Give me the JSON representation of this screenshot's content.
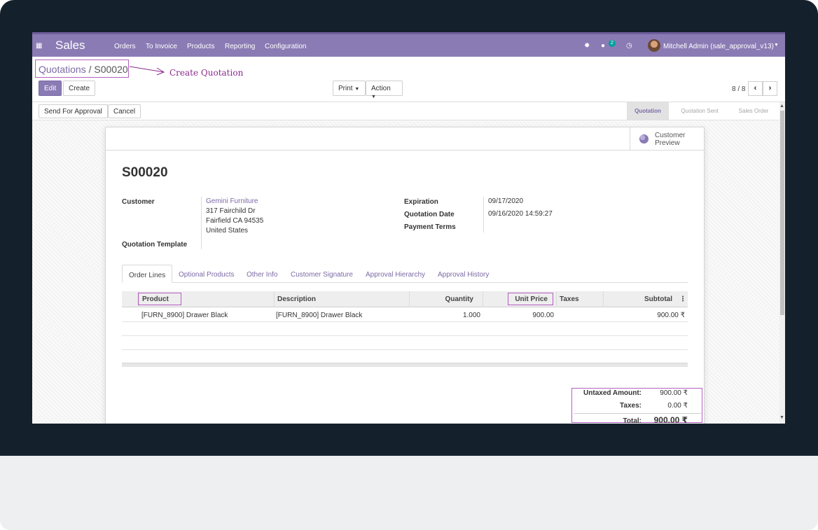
{
  "navbar": {
    "brand": "Sales",
    "menu": [
      "Orders",
      "To Invoice",
      "Products",
      "Reporting",
      "Configuration"
    ],
    "chat_badge": "2",
    "user": "Mitchell Admin (sale_approval_v13)"
  },
  "breadcrumb": {
    "parent": "Quotations",
    "separator": "/",
    "current": "S00020"
  },
  "annotation": "Create Quotation",
  "buttons": {
    "edit": "Edit",
    "create": "Create",
    "print": "Print",
    "action": "Action",
    "send_approval": "Send For Approval",
    "cancel": "Cancel"
  },
  "pager": "8 / 8",
  "stages": [
    "Quotation",
    "Quotation Sent",
    "Sales Order"
  ],
  "smart_button": {
    "line1": "Customer",
    "line2": "Preview"
  },
  "record": {
    "name": "S00020",
    "customer_label": "Customer",
    "customer_name": "Gemini Furniture",
    "address": [
      "317 Fairchild Dr",
      "Fairfield CA 94535",
      "United States"
    ],
    "template_label": "Quotation Template",
    "expiration_label": "Expiration",
    "expiration": "09/17/2020",
    "quotation_date_label": "Quotation Date",
    "quotation_date": "09/16/2020 14:59:27",
    "payment_terms_label": "Payment Terms"
  },
  "tabs": [
    "Order Lines",
    "Optional Products",
    "Other Info",
    "Customer Signature",
    "Approval Hierarchy",
    "Approval History"
  ],
  "table": {
    "columns": [
      "Product",
      "Description",
      "Quantity",
      "Unit Price",
      "Taxes",
      "Subtotal"
    ],
    "rows": [
      {
        "product": "[FURN_8900] Drawer Black",
        "description": "[FURN_8900] Drawer Black",
        "quantity": "1.000",
        "unit_price": "900.00",
        "taxes": "",
        "subtotal": "900.00 ₹"
      }
    ]
  },
  "totals": {
    "untaxed_label": "Untaxed Amount:",
    "untaxed": "900.00 ₹",
    "taxes_label": "Taxes:",
    "taxes": "0.00 ₹",
    "total_label": "Total:",
    "total": "900.00 ₹"
  },
  "colors": {
    "brand": "#8a7bb4",
    "highlight": "#b45ec1",
    "frame": "#14212c"
  }
}
